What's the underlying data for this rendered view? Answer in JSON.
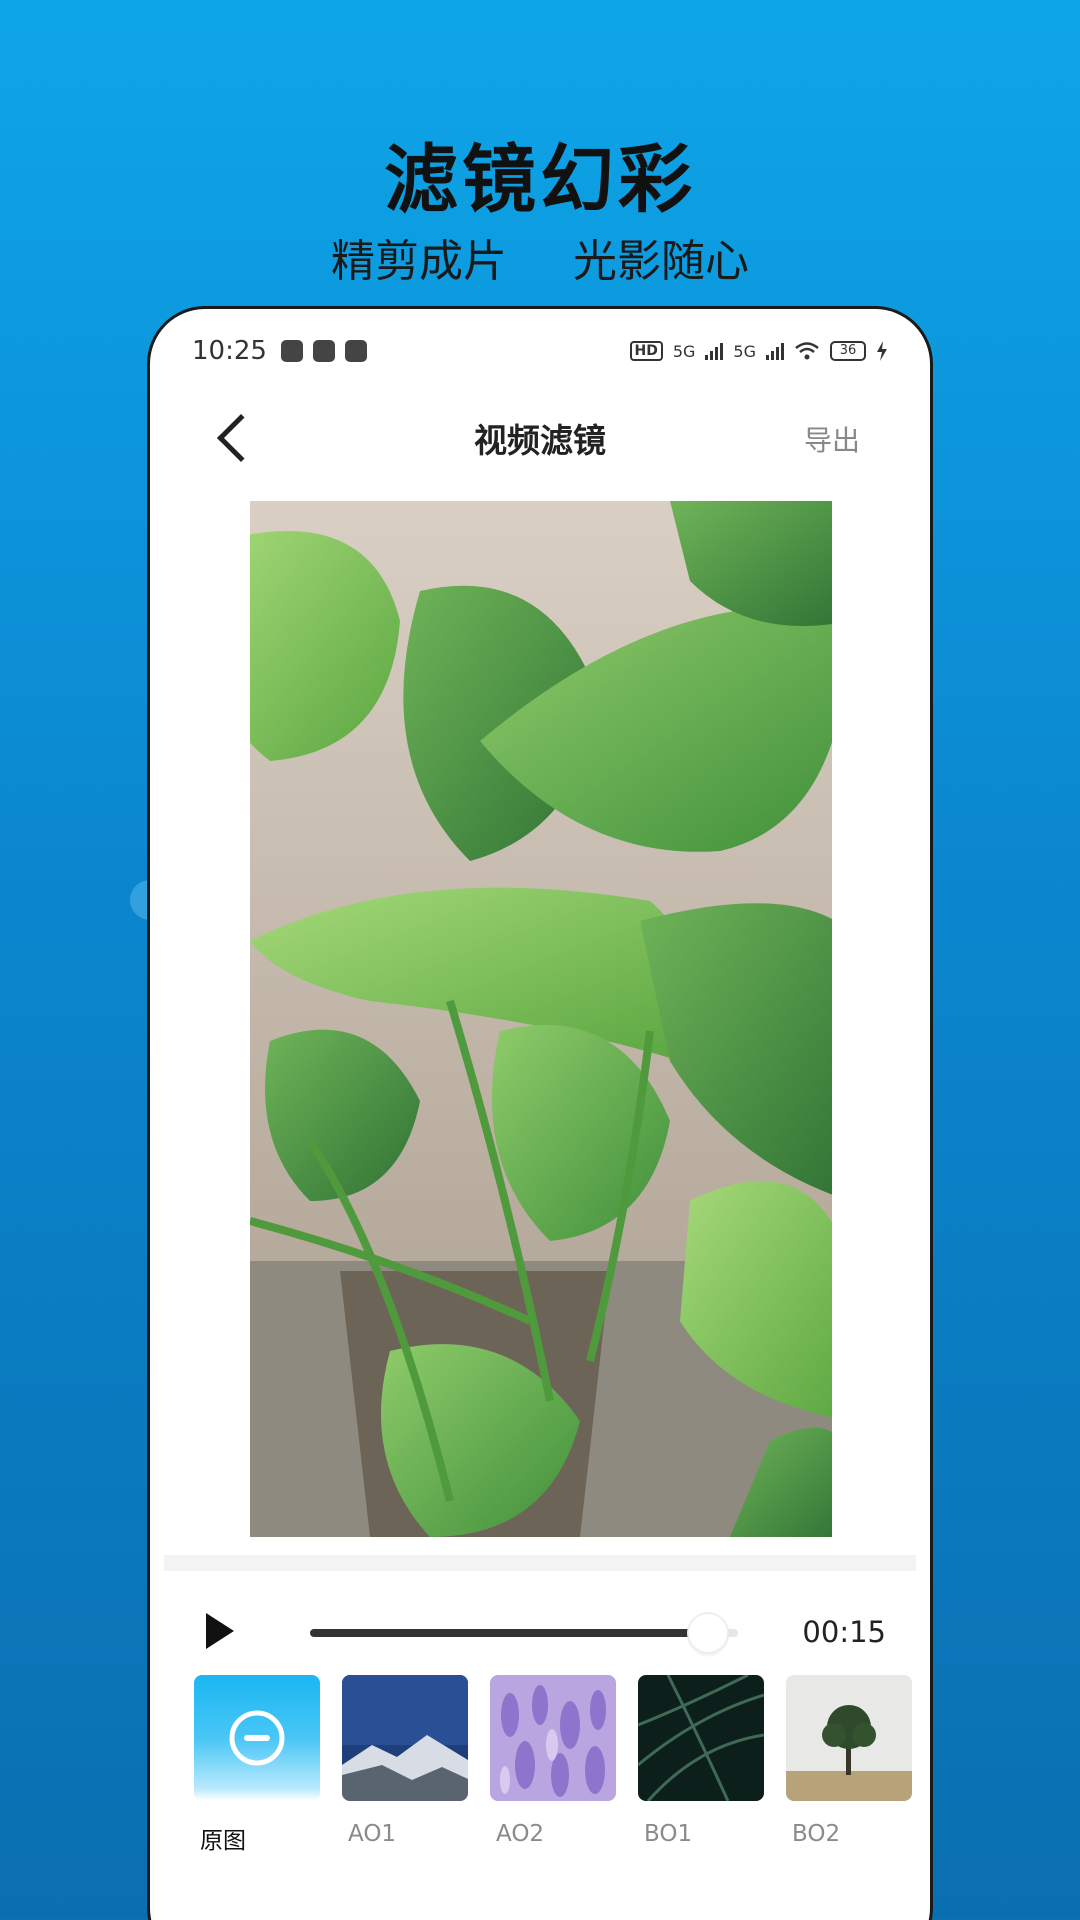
{
  "promo": {
    "headline": "滤镜幻彩",
    "tagline_left": "精剪成片",
    "tagline_right": "光影随心"
  },
  "statusbar": {
    "time": "10:25",
    "network_1": "5G",
    "network_2": "5G",
    "battery": "36"
  },
  "navbar": {
    "title": "视频滤镜",
    "export_label": "导出"
  },
  "player": {
    "duration": "00:15",
    "progress": 0.93
  },
  "filters": [
    {
      "label": "原图",
      "icon": "no-filter-icon"
    },
    {
      "label": "AO1"
    },
    {
      "label": "AO2"
    },
    {
      "label": "BO1"
    },
    {
      "label": "BO2"
    }
  ],
  "colors": {
    "background_top": "#0ea5e8",
    "background_bottom": "#0a6fb0",
    "active_filter": "#29b6f0"
  }
}
